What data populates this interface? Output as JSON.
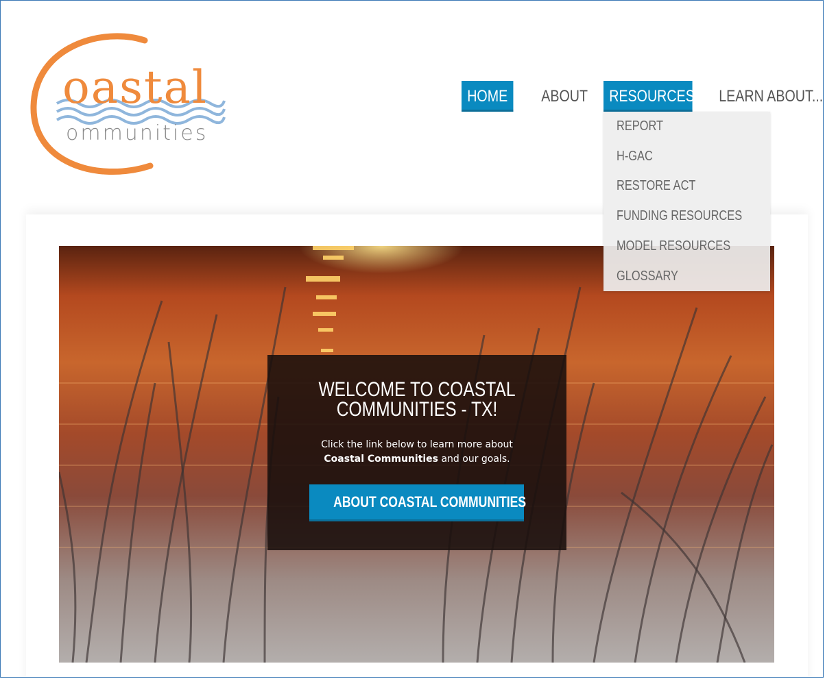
{
  "logo": {
    "word_top": "oastal",
    "word_bottom": "ommunities",
    "colors": {
      "orange": "#ef8a3c",
      "wave_blue": "#8fb6dc",
      "grey": "#8a8a8a"
    }
  },
  "nav": {
    "items": [
      {
        "label": "HOME",
        "active": true
      },
      {
        "label": "ABOUT",
        "active": false
      },
      {
        "label": "RESOURCES",
        "active": true
      },
      {
        "label": "LEARN ABOUT..."
      }
    ],
    "accent_color": "#0a8ac0"
  },
  "dropdown": {
    "items": [
      "REPORT",
      "H-GAC",
      "RESTORE ACT",
      "FUNDING RESOURCES",
      "MODEL RESOURCES",
      "GLOSSARY"
    ]
  },
  "hero": {
    "title": "WELCOME TO COASTAL COMMUNITIES - TX!",
    "text_before": "Click the link below to learn more about",
    "text_bold": "Coastal Communities",
    "text_after": "and our goals.",
    "button_label": "ABOUT COASTAL COMMUNITIES"
  }
}
